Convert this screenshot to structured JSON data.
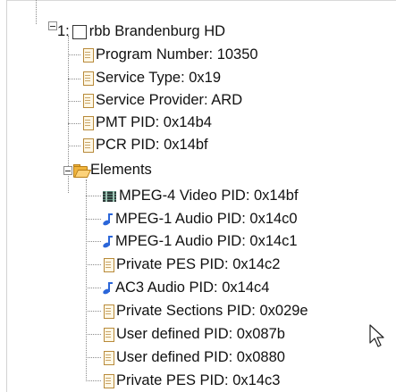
{
  "tree": {
    "root": {
      "index_label": "1:",
      "name": "rbb Brandenburg HD"
    },
    "properties": [
      {
        "key": "program_number",
        "text": "Program Number: 10350"
      },
      {
        "key": "service_type",
        "text": "Service Type: 0x19"
      },
      {
        "key": "service_provider",
        "text": "Service Provider: ARD"
      },
      {
        "key": "pmt_pid",
        "text": "PMT PID: 0x14b4"
      },
      {
        "key": "pcr_pid",
        "text": "PCR PID: 0x14bf"
      }
    ],
    "elements_folder": {
      "label": "Elements"
    },
    "elements": [
      {
        "icon": "video-icon",
        "text": "MPEG-4 Video PID: 0x14bf"
      },
      {
        "icon": "audio-icon",
        "text": "MPEG-1 Audio PID: 0x14c0"
      },
      {
        "icon": "audio-icon",
        "text": "MPEG-1 Audio PID: 0x14c1"
      },
      {
        "icon": "document-icon",
        "text": "Private PES PID: 0x14c2"
      },
      {
        "icon": "audio-icon",
        "text": "AC3 Audio PID: 0x14c4"
      },
      {
        "icon": "document-icon",
        "text": "Private Sections PID: 0x029e"
      },
      {
        "icon": "document-icon",
        "text": "User defined PID: 0x087b"
      },
      {
        "icon": "document-icon",
        "text": "User defined PID: 0x0880"
      },
      {
        "icon": "document-icon",
        "text": "Private PES PID: 0x14c3"
      }
    ]
  },
  "colors": {
    "audio_icon": "#2b66d9",
    "folder_icon": "#f0b43c",
    "tree_line": "#8a8a8a"
  }
}
